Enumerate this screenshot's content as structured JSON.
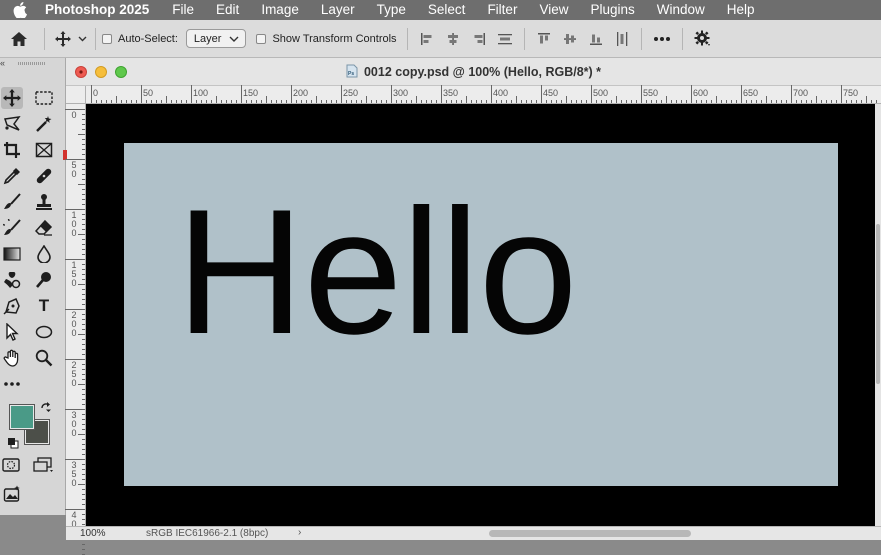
{
  "menubar": {
    "app_name": "Photoshop 2025",
    "items": [
      "File",
      "Edit",
      "Image",
      "Layer",
      "Type",
      "Select",
      "Filter",
      "View",
      "Plugins",
      "Window",
      "Help"
    ]
  },
  "options_bar": {
    "auto_select_label": "Auto-Select:",
    "auto_select_value": "Layer",
    "show_transform_label": "Show Transform Controls",
    "auto_select_checked": false,
    "show_transform_checked": false
  },
  "document": {
    "title": "0012 copy.psd @ 100% (Hello, RGB/8*) *",
    "canvas_text": "Hello",
    "canvas_color": "#b0c1c9",
    "background_color": "#000000"
  },
  "rulers": {
    "horizontal_labels": [
      "0",
      "50",
      "100",
      "150",
      "200",
      "250",
      "300",
      "350",
      "400",
      "450",
      "500",
      "550",
      "600",
      "650",
      "700",
      "750"
    ],
    "vertical_labels": [
      "0",
      "50",
      "100",
      "150",
      "200",
      "250",
      "300",
      "350",
      "400"
    ]
  },
  "tools": [
    {
      "name": "move-tool",
      "icon": "move-icon",
      "active": true
    },
    {
      "name": "marquee-tool",
      "icon": "marquee-icon"
    },
    {
      "name": "lasso-tool",
      "icon": "lasso-icon"
    },
    {
      "name": "magic-wand-tool",
      "icon": "magic-wand-icon"
    },
    {
      "name": "crop-tool",
      "icon": "crop-icon"
    },
    {
      "name": "frame-tool",
      "icon": "frame-icon"
    },
    {
      "name": "eyedropper-tool",
      "icon": "eyedropper-icon"
    },
    {
      "name": "healing-brush-tool",
      "icon": "bandage-icon"
    },
    {
      "name": "brush-tool",
      "icon": "brush-icon"
    },
    {
      "name": "clone-stamp-tool",
      "icon": "stamp-icon"
    },
    {
      "name": "history-brush-tool",
      "icon": "history-brush-icon"
    },
    {
      "name": "eraser-tool",
      "icon": "eraser-icon"
    },
    {
      "name": "gradient-tool",
      "icon": "gradient-icon"
    },
    {
      "name": "blur-tool",
      "icon": "drop-icon"
    },
    {
      "name": "dodge-tool",
      "icon": "dodge-icon"
    },
    {
      "name": "burn-tool",
      "icon": "burn-icon"
    },
    {
      "name": "pen-tool",
      "icon": "pen-icon"
    },
    {
      "name": "type-tool",
      "icon": "type-icon",
      "glyph": "T"
    },
    {
      "name": "path-selection-tool",
      "icon": "arrow-pointer-icon"
    },
    {
      "name": "ellipse-tool",
      "icon": "ellipse-icon"
    },
    {
      "name": "hand-tool",
      "icon": "hand-icon"
    },
    {
      "name": "zoom-tool",
      "icon": "zoom-icon"
    },
    {
      "name": "more-tools",
      "icon": "more-icon",
      "glyph": "•••"
    }
  ],
  "colors": {
    "foreground": "#4a9a87",
    "background": "#4c4f49"
  },
  "status_bar": {
    "zoom": "100%",
    "color_profile": "sRGB IEC61966-2.1 (8bpc)",
    "arrow": "›"
  }
}
